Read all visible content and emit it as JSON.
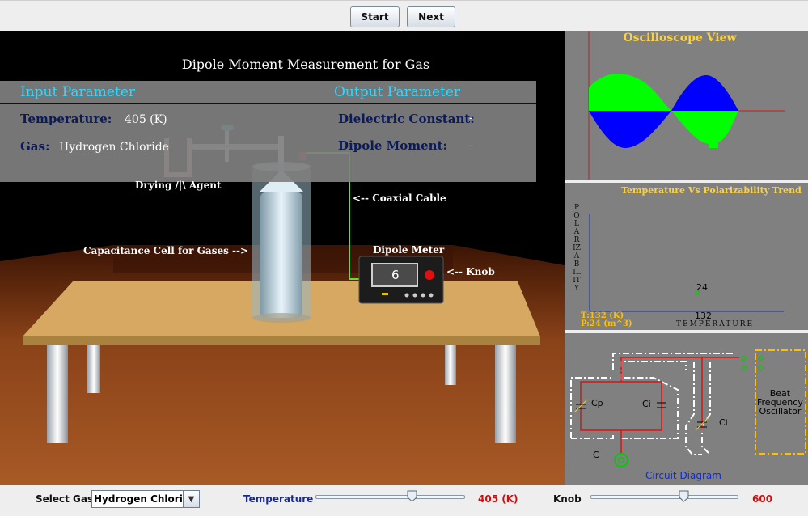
{
  "toolbar": {
    "start_label": "Start",
    "next_label": "Next"
  },
  "scene": {
    "title": "Dipole Moment Measurement for Gas",
    "input_header": "Input Parameter",
    "output_header": "Output Parameter",
    "temperature_label": "Temperature:",
    "temperature_value": "405 (K)",
    "gas_label": "Gas:",
    "gas_value": "Hydrogen Chloride",
    "dielectric_label": "Dielectric Constant:",
    "dielectric_value": "-",
    "dipole_label": "Dipole Moment:",
    "dipole_value": "-",
    "drying_agent_label": "Drying /|\\ Agent",
    "coaxial_label": "<-- Coaxial Cable",
    "cell_label": "Capacitance Cell for Gases -->",
    "meter_label": "Dipole Meter",
    "knob_label": "<-- Knob",
    "meter_display": "6"
  },
  "oscilloscope": {
    "title": "Oscilloscope View"
  },
  "trend": {
    "title": "Temperature Vs Polarizability Trend",
    "ylabel": "POLARIZABILITY",
    "xlabel": "TEMPERATURE",
    "point_t_label": "132",
    "point_p_label": "24",
    "t_readout": "T:132 (K)",
    "p_readout": "P:24 (m^3)"
  },
  "circuit": {
    "title": "Circuit Diagram",
    "cp_label": "Cp",
    "ci_label": "Ci",
    "ct_label": "Ct",
    "c_label": "C",
    "oscillator_label": "Beat\nFrequency\nOscillator",
    "oscillator_line1": "Beat",
    "oscillator_line2": "Frequency",
    "oscillator_line3": "Oscillator"
  },
  "controls": {
    "select_gas_label": "Select Gas",
    "gas_selected": "Hydrogen Chloride",
    "temperature_label": "Temperature",
    "temperature_value": "405 (K)",
    "temperature_slider_fraction": 0.66,
    "knob_label": "Knob",
    "knob_value": "600",
    "knob_slider_fraction": 0.64
  },
  "colors": {
    "accent_cyan": "#2fd8ff",
    "value_red": "#d01010",
    "osc_green": "#00ff00",
    "osc_blue": "#0000ff",
    "title_gold": "#ffd23a"
  }
}
